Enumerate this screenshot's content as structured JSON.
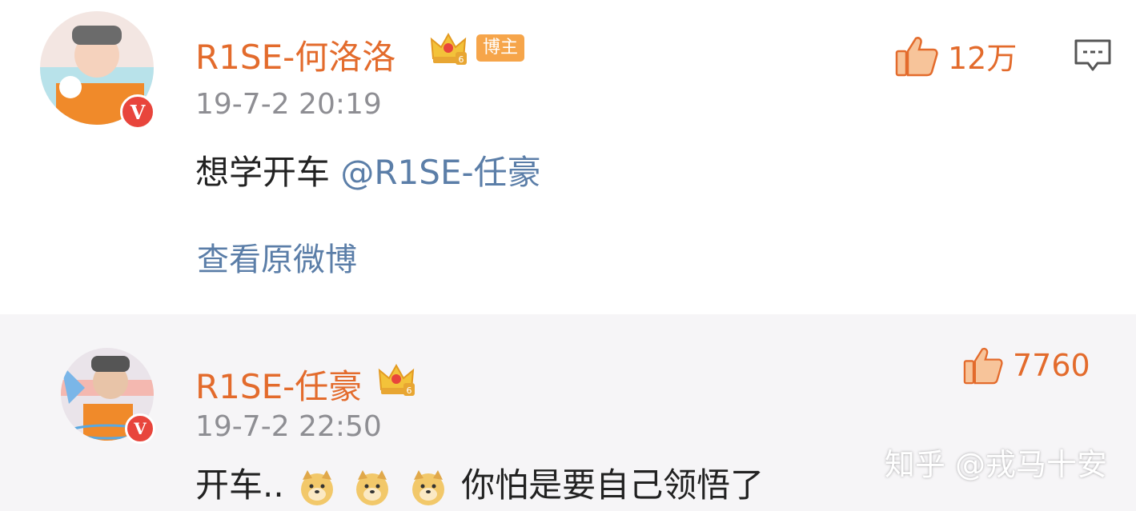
{
  "comments": [
    {
      "username": "R1SE-何洛洛",
      "level": "6",
      "badge": "博主",
      "verified_mark": "V",
      "time": "19-7-2 20:19",
      "text": "想学开车",
      "mention": "@R1SE-任豪",
      "view_original": "查看原微博",
      "likes": "12万"
    },
    {
      "username": "R1SE-任豪",
      "level": "6",
      "verified_mark": "V",
      "time": "19-7-2 22:50",
      "text_before": "开车..",
      "text_after": "你怕是要自己领悟了",
      "likes": "7760"
    }
  ],
  "watermark": "知乎 @戎马十安",
  "colors": {
    "username": "#e36b2c",
    "link": "#5b7ea8",
    "time": "#8e8e93",
    "badge": "#f6a54a",
    "verified": "#e8453c",
    "second_bg": "#f6f5f7"
  }
}
